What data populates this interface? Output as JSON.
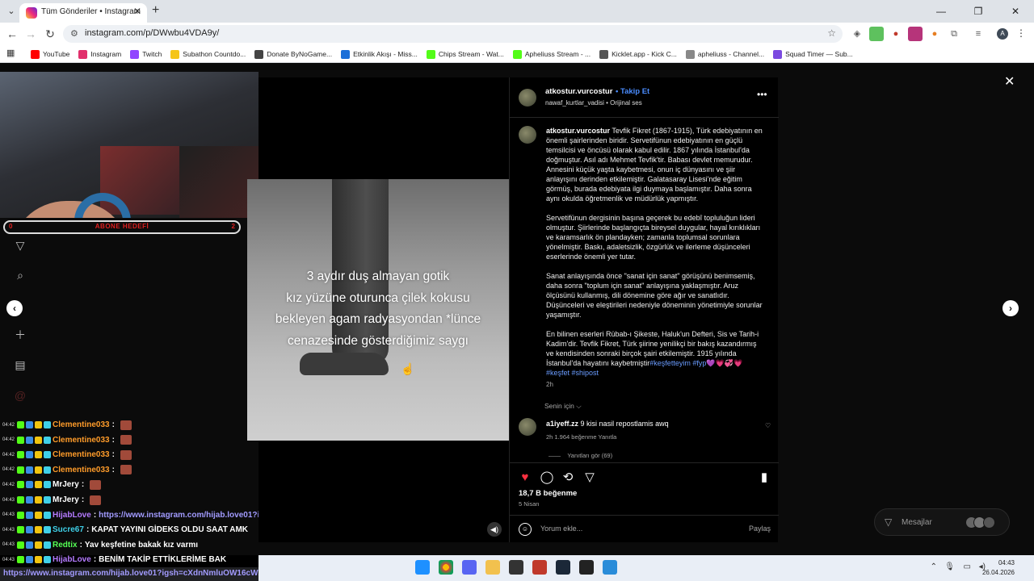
{
  "browser": {
    "tab_title": "Tüm Gönderiler • Instagram",
    "url": "instagram.com/p/DWwbu4VDA9y/",
    "bookmarks": [
      {
        "label": "YouTube",
        "color": "#ff0000"
      },
      {
        "label": "Instagram",
        "color": "#e1306c"
      },
      {
        "label": "Twitch",
        "color": "#9146ff"
      },
      {
        "label": "Subathon Countdo...",
        "color": "#f5c518"
      },
      {
        "label": "Donate ByNoGame...",
        "color": "#444444"
      },
      {
        "label": "Etkinlik Akışı - Miss...",
        "color": "#1b6fd8"
      },
      {
        "label": "Chips Stream - Wat...",
        "color": "#53fc18"
      },
      {
        "label": "Apheliuss Stream - ...",
        "color": "#53fc18"
      },
      {
        "label": "Kicklet.app - Kick C...",
        "color": "#555555"
      },
      {
        "label": "apheliuss - Channel...",
        "color": "#888888"
      },
      {
        "label": "Squad Timer — Sub...",
        "color": "#7b4ae0"
      }
    ]
  },
  "stream_overlay": {
    "goal_label": "ABONE HEDEFİ",
    "goal_current": "0",
    "goal_target": "2"
  },
  "chat": {
    "lines": [
      {
        "time": "04:42",
        "user": "Clementine033",
        "sep": ":",
        "text": "",
        "color": "#ff9c2a",
        "emote": true
      },
      {
        "time": "04:42",
        "user": "Clementine033",
        "sep": ":",
        "text": "",
        "color": "#ff9c2a",
        "emote": true
      },
      {
        "time": "04:42",
        "user": "Clementine033",
        "sep": ":",
        "text": "",
        "color": "#ff9c2a",
        "emote": true
      },
      {
        "time": "04:42",
        "user": "Clementine033",
        "sep": ":",
        "text": "",
        "color": "#ff9c2a",
        "emote": true
      },
      {
        "time": "04:42",
        "user": "MrJery",
        "sep": ":",
        "text": "",
        "color": "#ffffff",
        "emote": true
      },
      {
        "time": "04:43",
        "user": "MrJery",
        "sep": ":",
        "text": "",
        "color": "#ffffff",
        "emote": true
      },
      {
        "time": "04:43",
        "user": "HijabLove",
        "sep": ":",
        "text": "https://www.instagram.com/hijab.love01?igsh=cXdnNmluOW16cWxk",
        "color": "#b57bff",
        "emote": false,
        "link": true
      },
      {
        "time": "04:43",
        "user": "Sucre67",
        "sep": ":",
        "text": "KAPAT YAYINI GİDEKS OLDU SAAT AMK",
        "color": "#3fd0e8",
        "emote": false
      },
      {
        "time": "04:43",
        "user": "Redtix",
        "sep": ":",
        "text": "Yav keşfetine bakak kız varmı",
        "color": "#55ff55",
        "emote": false
      },
      {
        "time": "04:43",
        "user": "HijabLove",
        "sep": ":",
        "text": "BENİM TAKİP ETTİKLERİME BAK",
        "color": "#b57bff",
        "emote": false
      }
    ],
    "bottom_link": "https://www.instagram.com/hijab.love01?igsh=cXdnNmluOW16cWxk"
  },
  "reel": {
    "caption_lines": [
      "3 aydır duş almayan gotik",
      "kız yüzüne oturunca çilek kokusu",
      "bekleyen agam radyasyondan *lünce",
      "cenazesinde gösterdiğimiz saygı"
    ]
  },
  "post": {
    "username": "atkostur.vurcostur",
    "follow_label": "Takip Et",
    "audio": "nawaf_kurtlar_vadisi • Orijinal ses",
    "caption_p1": "Tevfik Fikret (1867-1915), Türk edebiyatının en önemli şairlerinden biridir. Servetifünun edebiyatının en güçlü temsilcisi ve öncüsü olarak kabul edilir. 1867 yılında İstanbul'da doğmuştur. Asıl adı Mehmet Tevfik'tir. Babası devlet memurudur. Annesini küçük yaşta kaybetmesi, onun iç dünyasını ve şiir anlayışını derinden etkilemiştir. Galatasaray Lisesi'nde eğitim görmüş, burada edebiyata ilgi duymaya başlamıştır. Daha sonra aynı okulda öğretmenlik ve müdürlük yapmıştır.",
    "caption_p2": "Servetifünun dergisinin başına geçerek bu edebî topluluğun lideri olmuştur. Şiirlerinde başlangıçta bireysel duygular, hayal kırıklıkları ve karamsarlık ön plandayken; zamanla toplumsal sorunlara yönelmiştir. Baskı, adaletsizlik, özgürlük ve ilerleme düşünceleri eserlerinde önemli yer tutar.",
    "caption_p3": "Sanat anlayışında önce \"sanat için sanat\" görüşünü benimsemiş, daha sonra \"toplum için sanat\" anlayışına yaklaşmıştır. Aruz ölçüsünü kullanmış, dili dönemine göre ağır ve sanatlıdır. Düşünceleri ve eleştirileri nedeniyle döneminin yönetimiyle sorunlar yaşamıştır.",
    "caption_p4": "En bilinen eserleri Rübab-ı Şikeste, Haluk'un Defteri, Sis ve Tarih-i Kadim'dir. Tevfik Fikret, Türk şiirine yenilikçi bir bakış kazandırmış ve kendisinden sonraki birçok şairi etkilemiştir. 1915 yılında İstanbul'da hayatını kaybetmiştir",
    "tags": "#keşfetteyim #fyp💜💗💞💗",
    "tags2": "#keşfet #shipost",
    "caption_time": "2h",
    "for_you": "Senin için ⌵",
    "comment_user": "a1iyeff.zz",
    "comment_text": "9 kisi nasil repostlamis awq",
    "comment_meta": "2h   1.964 beğenme   Yanıtla",
    "replies": "Yanıtları gör (69)",
    "likes": "18,7 B beğenme",
    "date": "5 Nisan",
    "comment_placeholder": "Yorum ekle...",
    "share_label": "Paylaş"
  },
  "messages": {
    "label": "Mesajlar"
  },
  "taskbar": {
    "time": "04:43",
    "date": "26.04.2026"
  }
}
